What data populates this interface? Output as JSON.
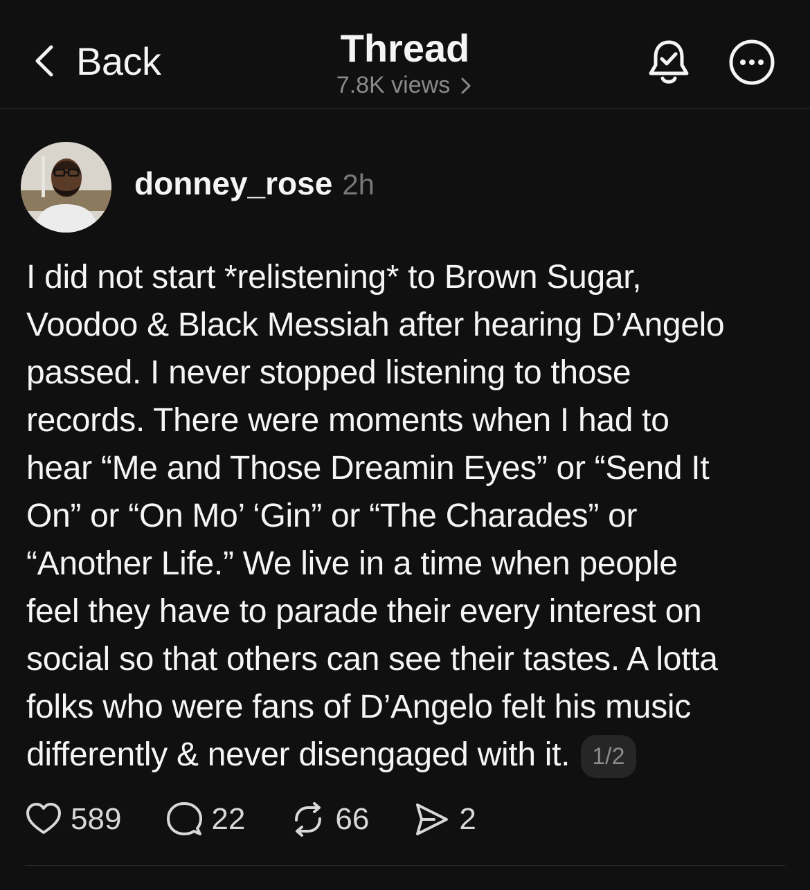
{
  "header": {
    "back_label": "Back",
    "title": "Thread",
    "views": "7.8K views"
  },
  "post": {
    "username": "donney_rose",
    "timestamp": "2h",
    "lines": [
      "I did not start *relistening* to Brown Sugar,",
      "Voodoo & Black Messiah after hearing D’Angelo",
      "passed. I never stopped listening to those",
      "records. There were moments when I had to",
      "hear “Me and Those Dreamin Eyes” or “Send It",
      "On” or “On Mo’ ‘Gin” or “The Charades” or",
      "“Another Life.” We live in a time when people",
      "feel they have to parade their every interest on",
      "social so that others can see their tastes. A lotta",
      "folks who were fans of D’Angelo felt his music",
      "differently & never disengaged with it."
    ],
    "page_indicator": "1/2",
    "likes": "589",
    "replies": "22",
    "reposts": "66",
    "shares": "2"
  },
  "icons": {
    "back": "chevron-left-icon",
    "views": "chevron-right-icon",
    "bell": "bell-check-icon",
    "more": "more-circle-icon",
    "like": "heart-icon",
    "reply": "comment-icon",
    "repost": "repost-icon",
    "share": "send-icon"
  }
}
